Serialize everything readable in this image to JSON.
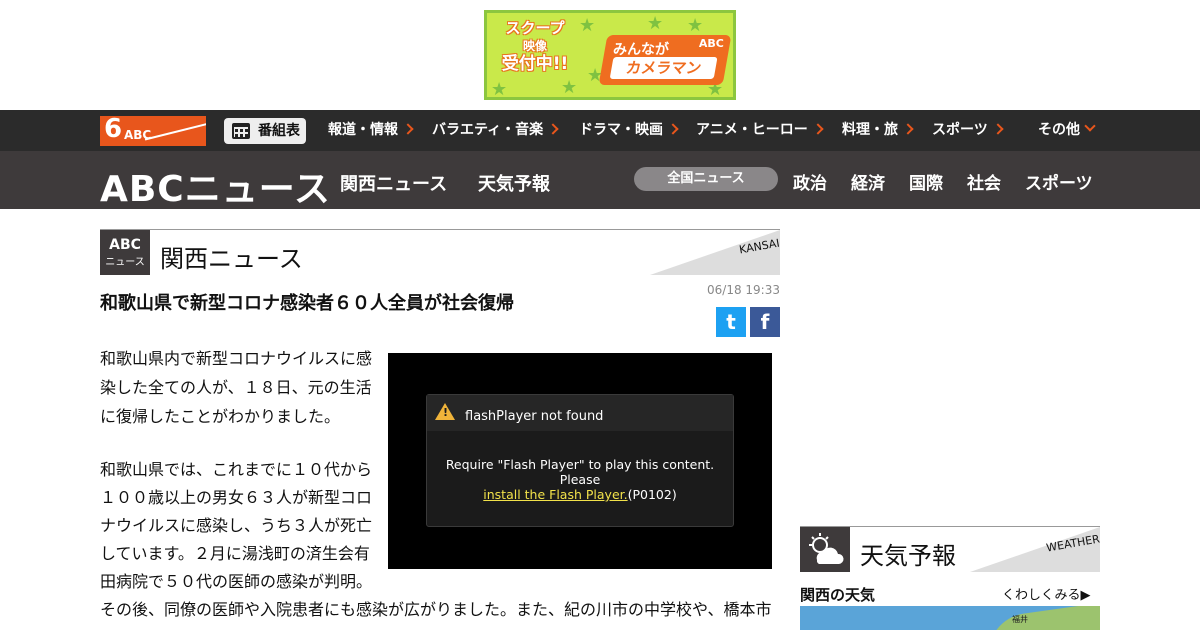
{
  "ad": {
    "scoop_line1": "スクープ",
    "scoop_line2": "映像",
    "scoop_line3": "受付中!!",
    "plate_top": "みんなが",
    "plate_main": "カメラマン",
    "plate_brand": "ABC"
  },
  "topnav": {
    "logo_num": "6",
    "logo_text": "ABC",
    "bangumi": "番組表",
    "items": [
      "報道・情報",
      "バラエティ・音楽",
      "ドラマ・映画",
      "アニメ・ヒーロー",
      "料理・旅",
      "スポーツ",
      "その他"
    ]
  },
  "newsbar": {
    "logo": "ABCニュース",
    "links": [
      "関西ニュース",
      "天気予報"
    ],
    "active_tab": "全国ニュース",
    "categories": [
      "政治",
      "経済",
      "国際",
      "社会",
      "スポーツ"
    ]
  },
  "section": {
    "badge_line1": "ABC",
    "badge_line2": "ニュース",
    "title": "関西ニュース",
    "tag": "KANSAI"
  },
  "article": {
    "headline": "和歌山県で新型コロナ感染者６０人全員が社会復帰",
    "datetime": "06/18 19:33",
    "para1": "和歌山県内で新型コロナウイルスに感染した全ての人が、１８日、元の生活に復帰したことがわかりました。",
    "para2": "和歌山県では、これまでに１０代から１００歳以上の男女６３人が新型コロナウイルスに感染し、うち３人が死亡しています。２月に湯浅町の済生会有田病院で５０代の医師の感染が判明。",
    "para3": "その後、同僚の医師や入院患者にも感染が広がりました。また、紀の川市の中学校や、橋本市"
  },
  "social": {
    "twitter": "t",
    "facebook": "f"
  },
  "video": {
    "title": "flashPlayer not found",
    "line1": "Require \"Flash Player\" to play this content.",
    "line2": "Please",
    "link": "install the Flash Player.",
    "code": "(P0102)"
  },
  "weather": {
    "title": "天気予報",
    "tag": "WEATHER",
    "region": "関西の天気",
    "more": "くわしくみる▶",
    "map_city": "福井"
  },
  "colors": {
    "accent": "#e8561c",
    "dark": "#2b2b2b",
    "newsbar": "#3e3a3b",
    "twitter": "#1da1f2",
    "facebook": "#3b5998"
  }
}
